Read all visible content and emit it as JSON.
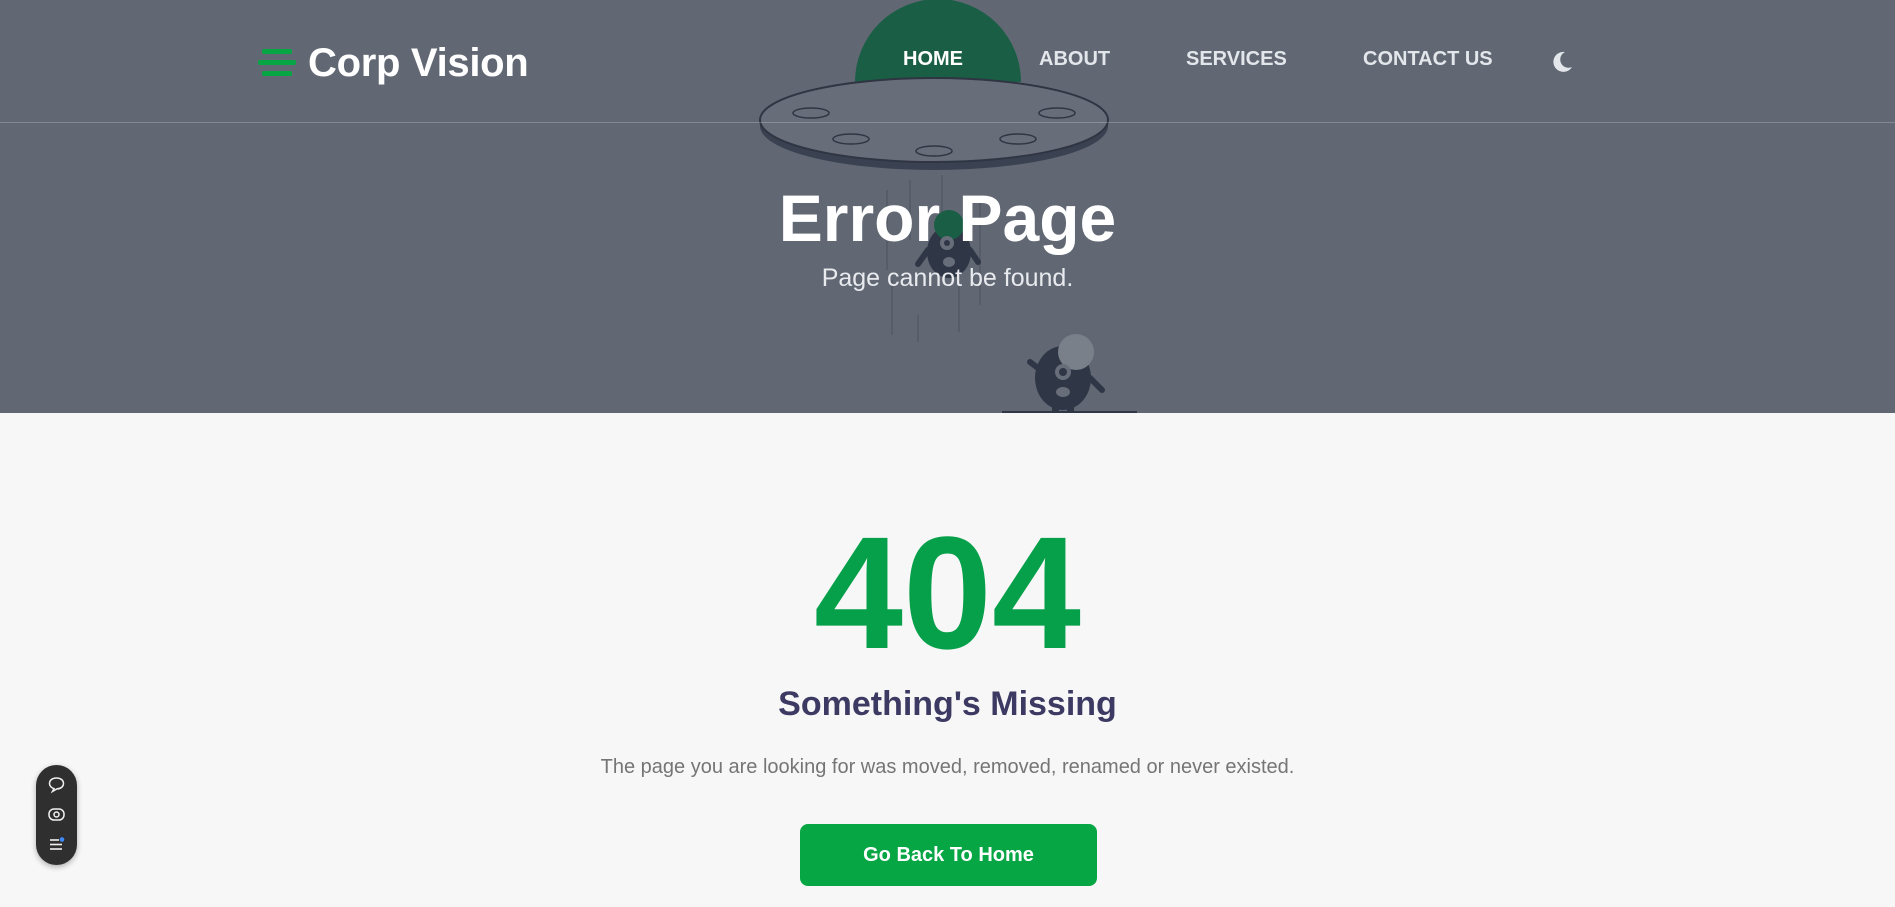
{
  "brand": {
    "name": "Corp Vision",
    "icon": "menu-lines-icon"
  },
  "nav": {
    "items": [
      {
        "label": "HOME",
        "active": true
      },
      {
        "label": "ABOUT",
        "active": false
      },
      {
        "label": "SERVICES",
        "active": false
      },
      {
        "label": "CONTACT US",
        "active": false
      }
    ],
    "theme_toggle_icon": "moon-icon"
  },
  "hero": {
    "title": "Error Page",
    "subtitle": "Page cannot be found."
  },
  "error": {
    "code": "404",
    "heading": "Something's Missing",
    "message": "The page you are looking for was moved, removed, renamed or never existed.",
    "button_label": "Go Back To Home"
  },
  "toolbar": {
    "icons": [
      "chat-bubble-icon",
      "eye-icon",
      "list-settings-icon"
    ]
  },
  "colors": {
    "hero_bg": "#616874",
    "accent_green": "#06a644",
    "code_green": "#06a04a",
    "heading_purple": "#3c3a63",
    "page_bg": "#f7f7f7"
  }
}
